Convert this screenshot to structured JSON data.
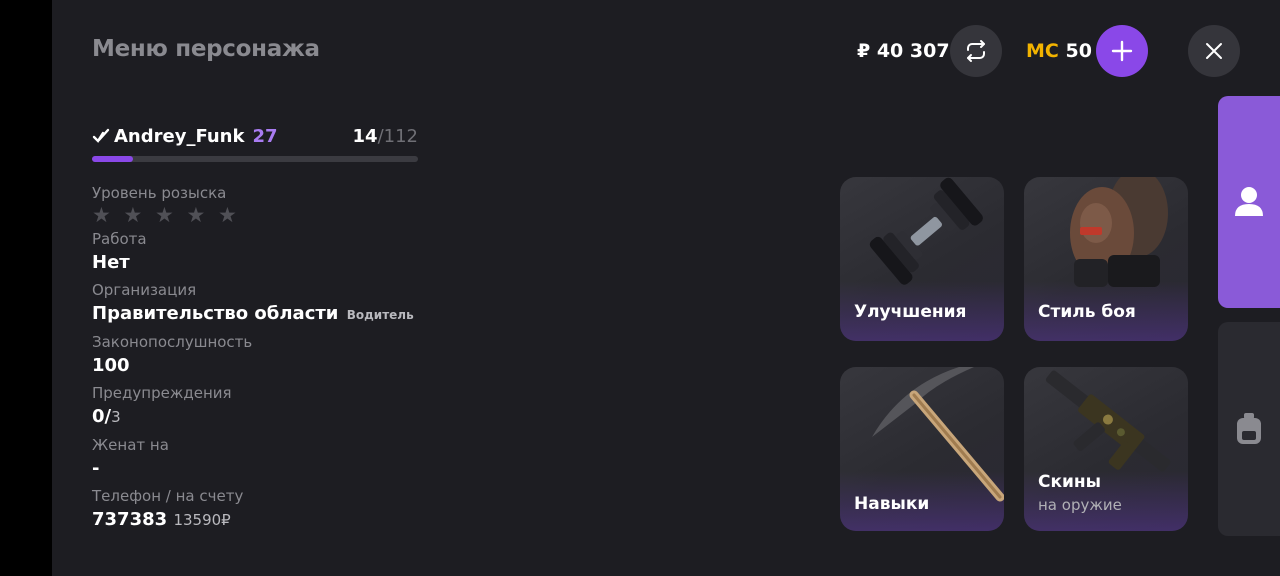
{
  "header": {
    "title": "Меню персонажа",
    "money": "₽ 40 307",
    "mc_label": "MC",
    "mc_value": "50"
  },
  "player": {
    "name": "Andrey_Funk",
    "level": "27",
    "xp_current": "14",
    "xp_max": "/112",
    "xp_progress": 0.125
  },
  "stats": {
    "wanted_label": "Уровень розыска",
    "wanted_stars": "★ ★ ★ ★ ★",
    "wanted_level": 0,
    "job_label": "Работа",
    "job_value": "Нет",
    "org_label": "Организация",
    "org_value": "Правительство области",
    "org_rank": "Водитель",
    "law_label": "Законопослушность",
    "law_value": "100",
    "warn_label": "Предупреждения",
    "warn_value": "0/",
    "warn_max": "3",
    "married_label": "Женат на",
    "married_value": "-",
    "phone_label": "Телефон / на счету",
    "phone_value": "737383",
    "phone_balance": "13590₽"
  },
  "cards": [
    {
      "label": "Улучшения",
      "icon": "dumbbell-icon"
    },
    {
      "label": "Стиль боя",
      "icon": "boxing-glove-icon"
    },
    {
      "label": "Навыки",
      "icon": "pickaxe-icon"
    },
    {
      "label": "Скины",
      "sub": "на оружие",
      "icon": "rifle-icon"
    }
  ],
  "sidebar": [
    {
      "icon": "person-icon",
      "active": true
    },
    {
      "icon": "backpack-icon",
      "active": false
    }
  ],
  "colors": {
    "accent": "#8a48e8",
    "mc": "#f2b300",
    "background": "#1d1d22"
  }
}
